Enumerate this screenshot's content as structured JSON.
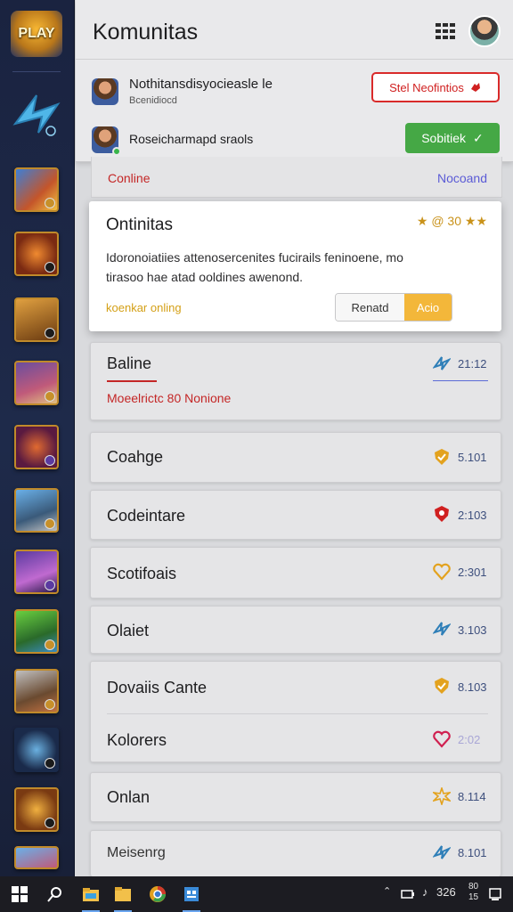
{
  "app": {
    "title": "Komunitas",
    "logo_text": "PLAY"
  },
  "requests": [
    {
      "name": "Nothitansdisyocieasle le",
      "sub": "Bcenidiocd"
    },
    {
      "text": "Roseicharmapd  sraols"
    }
  ],
  "buttons": {
    "notif_label": "Stel Neofintios",
    "submit_label": "Sobitiek"
  },
  "status": {
    "left": "Conline",
    "right": "Nocoand"
  },
  "popup": {
    "title": "Ontinitas",
    "rating": "★ @ 30 ★★",
    "description": "Idoronoiatiies attenosercenites fucirails feninoene, mo tirasoo hae atad ooldines awenond.",
    "online": "koenkar onling",
    "btn_cancel": "Renatd",
    "btn_accept": "Acio"
  },
  "cards": [
    {
      "name": "Baline",
      "value": "21:12",
      "sub": "Moeelrictc 80 Nonione",
      "icon": "arrow-icon",
      "color": "#2f7fb8"
    },
    {
      "name": "Coahge",
      "value": "5.101",
      "icon": "gold-shield-icon",
      "color": "#e3a21e"
    },
    {
      "name": "Codeintare",
      "value": "2:103",
      "icon": "red-shield-icon",
      "color": "#d02020"
    },
    {
      "name": "Scotifoais",
      "value": "2:301",
      "icon": "gold-heart-icon",
      "color": "#e3a21e"
    },
    {
      "name": "Olaiet",
      "value": "3.103",
      "icon": "arrow-icon",
      "color": "#2f7fb8"
    },
    {
      "name": "Dovaiis Cante",
      "value": "8.103",
      "icon": "gold-shield-icon",
      "color": "#e3a21e"
    },
    {
      "name": "Kolorers",
      "value": "2:02",
      "icon": "heart-icon",
      "color": "#d02050"
    },
    {
      "name": "Onlan",
      "value": "8.114",
      "icon": "star-burst-icon",
      "color": "#e3a21e"
    },
    {
      "name": "Meisenrg",
      "value": "8.101",
      "icon": "arrow-icon",
      "color": "#2f7fb8"
    }
  ],
  "taskbar": {
    "time": "326",
    "clock_top": "80",
    "clock_bottom": "15"
  }
}
